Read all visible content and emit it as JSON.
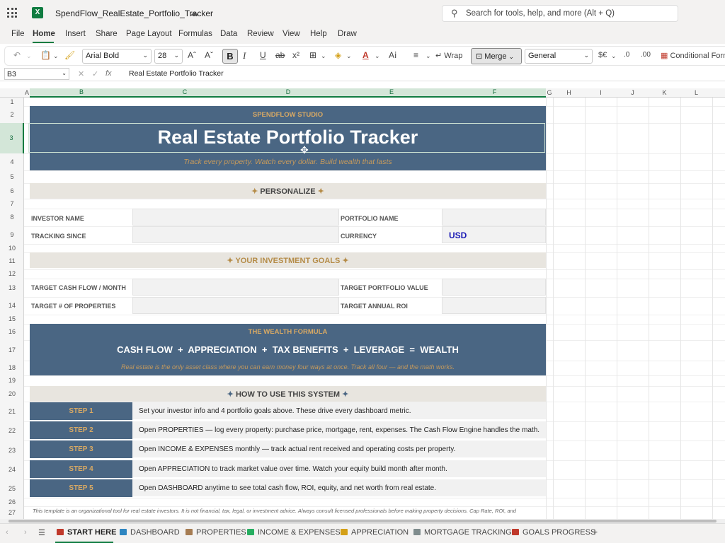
{
  "titlebar": {
    "filename": "SpendFlow_RealEstate_Portfolio_Tracker",
    "app_icon": "X",
    "search_placeholder": "Search for tools, help, and more (Alt + Q)"
  },
  "menu": [
    "File",
    "Home",
    "Insert",
    "Share",
    "Page Layout",
    "Formulas",
    "Data",
    "Review",
    "View",
    "Help",
    "Draw"
  ],
  "active_menu": "Home",
  "ribbon": {
    "font_name": "Arial Bold",
    "font_size": "28",
    "bold": "B",
    "italic": "I",
    "underline": "U",
    "strike": "ab",
    "font_grow": "A^",
    "font_shrink": "A˅",
    "a_label": "A",
    "wrap": "Wrap",
    "merge": "Merge",
    "number_format": "General",
    "currency": "$€",
    "conditional": "Conditional Forn"
  },
  "formula_bar": {
    "cell_ref": "B3",
    "content": "Real Estate Portfolio Tracker",
    "fx": "fx"
  },
  "columns": [
    "A",
    "B",
    "C",
    "D",
    "E",
    "F",
    "G",
    "H",
    "I",
    "J",
    "K",
    "L"
  ],
  "rows": [
    "1",
    "2",
    "3",
    "4",
    "5",
    "6",
    "7",
    "8",
    "9",
    "10",
    "11",
    "12",
    "13",
    "14",
    "15",
    "16",
    "17",
    "18",
    "19",
    "20",
    "21",
    "22",
    "23",
    "24",
    "25",
    "26",
    "27"
  ],
  "sheet": {
    "studio": "SPENDFLOW STUDIO",
    "title": "Real Estate Portfolio Tracker",
    "tagline": "Track every property. Watch every dollar. Build wealth that lasts",
    "personalize": "PERSONALIZE",
    "investor_name_label": "INVESTOR NAME",
    "tracking_since_label": "TRACKING SINCE",
    "portfolio_name_label": "PORTFOLIO NAME",
    "currency_label": "CURRENCY",
    "currency_value": "USD",
    "goals_title": "YOUR INVESTMENT GOALS",
    "target_cash_flow_label": "TARGET CASH FLOW / MONTH",
    "target_properties_label": "TARGET # OF PROPERTIES",
    "target_portfolio_value_label": "TARGET PORTFOLIO VALUE",
    "target_roi_label": "TARGET ANNUAL ROI",
    "wealth_title": "THE WEALTH FORMULA",
    "wealth_formula": "CASH FLOW  +  APPRECIATION  +  TAX BENEFITS  +  LEVERAGE  =  WEALTH",
    "wealth_note": "Real estate is the only asset class where you can earn money four ways at once. Track all four — and the math works.",
    "howto_title": "HOW TO USE THIS SYSTEM",
    "steps": [
      {
        "label": "STEP 1",
        "text": "Set your investor info and 4 portfolio goals above. These drive every dashboard metric."
      },
      {
        "label": "STEP 2",
        "text": "Open PROPERTIES — log every property: purchase price, mortgage, rent, expenses. The Cash Flow Engine handles the math."
      },
      {
        "label": "STEP 3",
        "text": "Open INCOME & EXPENSES monthly — track actual rent received and operating costs per property."
      },
      {
        "label": "STEP 4",
        "text": "Open APPRECIATION to track market value over time. Watch your equity build month after month."
      },
      {
        "label": "STEP 5",
        "text": "Open DASHBOARD anytime to see total cash flow, ROI, equity, and net worth from real estate."
      }
    ],
    "disclaimer": "This template is an organizational tool for real estate investors. It is not financial, tax, legal, or investment advice. Always consult licensed professionals before making property decisions. Cap Rate, ROI, and"
  },
  "tabs": [
    {
      "label": "START HERE",
      "color": "#c0392b"
    },
    {
      "label": "DASHBOARD",
      "color": "#2e86c1"
    },
    {
      "label": "PROPERTIES",
      "color": "#a67c52"
    },
    {
      "label": "INCOME & EXPENSES",
      "color": "#27ae60"
    },
    {
      "label": "APPRECIATION",
      "color": "#d4a017"
    },
    {
      "label": "MORTGAGE TRACKING",
      "color": "#7f8c8d"
    },
    {
      "label": "GOALS PROGRESS",
      "color": "#c0392b"
    }
  ],
  "colors": {
    "navy": "#4a6683",
    "gold": "#d8a964",
    "beige": "#e8e5df",
    "accent_green": "#107c41",
    "currency_blue": "#1a1ab5"
  }
}
